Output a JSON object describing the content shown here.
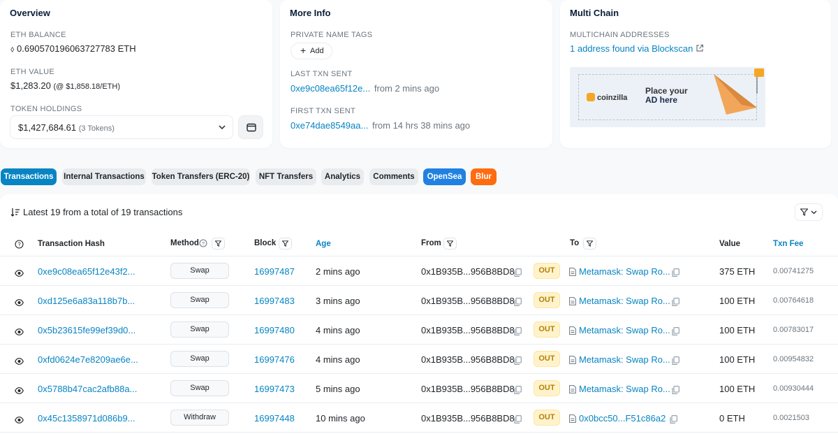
{
  "overview": {
    "title": "Overview",
    "eth_balance_label": "ETH BALANCE",
    "eth_balance": "0.690570196063727783 ETH",
    "eth_value_label": "ETH VALUE",
    "eth_value": "$1,283.20",
    "eth_price": "(@ $1,858.18/ETH)",
    "token_holdings_label": "TOKEN HOLDINGS",
    "token_holdings_value": "$1,427,684.61",
    "token_holdings_count": "(3 Tokens)"
  },
  "more_info": {
    "title": "More Info",
    "private_tags_label": "PRIVATE NAME TAGS",
    "add_label": "Add",
    "last_txn_label": "LAST TXN SENT",
    "last_txn_hash": "0xe9c08ea65f12e...",
    "last_txn_time": "from 2 mins ago",
    "first_txn_label": "FIRST TXN SENT",
    "first_txn_hash": "0xe74dae8549aa...",
    "first_txn_time": "from 14 hrs 38 mins ago"
  },
  "multi_chain": {
    "title": "Multi Chain",
    "addresses_label": "MULTICHAIN ADDRESSES",
    "addresses_link": "1 address found via Blockscan",
    "ad_brand": "coinzilla",
    "ad_line1": "Place your",
    "ad_line2": "AD here"
  },
  "tabs": [
    {
      "label": "Transactions",
      "active": true
    },
    {
      "label": "Internal Transactions"
    },
    {
      "label": "Token Transfers (ERC-20)"
    },
    {
      "label": "NFT Transfers"
    },
    {
      "label": "Analytics"
    },
    {
      "label": "Comments"
    },
    {
      "label": "OpenSea"
    },
    {
      "label": "Blur"
    }
  ],
  "table": {
    "summary": "Latest 19 from a total of 19 transactions",
    "headers": {
      "hash": "Transaction Hash",
      "method": "Method",
      "block": "Block",
      "age": "Age",
      "from": "From",
      "to": "To",
      "value": "Value",
      "fee": "Txn Fee"
    },
    "rows": [
      {
        "hash": "0xe9c08ea65f12e43f2...",
        "method": "Swap",
        "block": "16997487",
        "age": "2 mins ago",
        "from": "0x1B935B...956B8BD8",
        "direction": "OUT",
        "to": "Metamask: Swap Ro...",
        "value": "375 ETH",
        "fee": "0.00741275"
      },
      {
        "hash": "0xd125e6a83a118b7b...",
        "method": "Swap",
        "block": "16997483",
        "age": "3 mins ago",
        "from": "0x1B935B...956B8BD8",
        "direction": "OUT",
        "to": "Metamask: Swap Ro...",
        "value": "100 ETH",
        "fee": "0.00764618"
      },
      {
        "hash": "0x5b23615fe99ef39d0...",
        "method": "Swap",
        "block": "16997480",
        "age": "4 mins ago",
        "from": "0x1B935B...956B8BD8",
        "direction": "OUT",
        "to": "Metamask: Swap Ro...",
        "value": "100 ETH",
        "fee": "0.00783017"
      },
      {
        "hash": "0xfd0624e7e8209ae6e...",
        "method": "Swap",
        "block": "16997476",
        "age": "4 mins ago",
        "from": "0x1B935B...956B8BD8",
        "direction": "OUT",
        "to": "Metamask: Swap Ro...",
        "value": "100 ETH",
        "fee": "0.00954832"
      },
      {
        "hash": "0x5788b47cac2afb88a...",
        "method": "Swap",
        "block": "16997473",
        "age": "5 mins ago",
        "from": "0x1B935B...956B8BD8",
        "direction": "OUT",
        "to": "Metamask: Swap Ro...",
        "value": "100 ETH",
        "fee": "0.00930444"
      },
      {
        "hash": "0x45c1358971d086b9...",
        "method": "Withdraw",
        "block": "16997448",
        "age": "10 mins ago",
        "from": "0x1B935B...956B8BD8",
        "direction": "OUT",
        "to": "0x0bcc50...F51c86a2",
        "value": "0 ETH",
        "fee": "0.0021503"
      }
    ]
  }
}
